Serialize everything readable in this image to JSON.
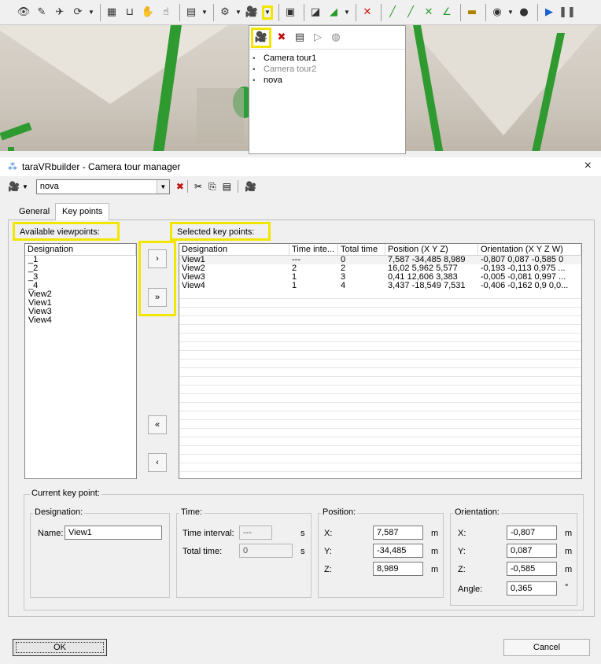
{
  "toolbar": {
    "icons": [
      "eye-icon",
      "walk-icon",
      "fly-icon",
      "rotate-icon",
      "grid-icon",
      "ruler-icon",
      "hand-icon",
      "pan-icon",
      "texture-icon",
      "settings-icon",
      "camera-icon",
      "camera-dropdown",
      "cube-icon",
      "chart-icon",
      "delete-icon",
      "line-icon",
      "measure-icon",
      "play-icon",
      "pause-icon"
    ]
  },
  "tour_panel": {
    "items": [
      {
        "label": "Camera tour1",
        "dim": false
      },
      {
        "label": "Camera tour2",
        "dim": true
      },
      {
        "label": "nova",
        "dim": false
      }
    ]
  },
  "dialog": {
    "title": "taraVRbuilder - Camera tour manager",
    "close": "×",
    "tour_select_value": "nova",
    "tabs": [
      "General",
      "Key points"
    ]
  },
  "available": {
    "label": "Available viewpoints:",
    "header": "Designation",
    "items": [
      "_1",
      "_2",
      "_3",
      "_4",
      "View2",
      "View1",
      "View3",
      "View4"
    ]
  },
  "buttons": {
    "add_one": "›",
    "add_all": "»",
    "remove_all": "«",
    "remove_one": "‹",
    "ok": "OK",
    "cancel": "Cancel"
  },
  "selected": {
    "label": "Selected key points:",
    "columns": [
      "Designation",
      "Time inte...",
      "Total time",
      "Position (X Y Z)",
      "Orientation (X Y Z W)"
    ],
    "rows": [
      [
        "View1",
        "---",
        "0",
        "7,587 -34,485 8,989",
        "-0,807 0,087 -0,585 0"
      ],
      [
        "View2",
        "2",
        "2",
        "16,02 5,962 5,577",
        "-0,193 -0,113 0,975 ..."
      ],
      [
        "View3",
        "1",
        "3",
        "0,41 12,606 3,383",
        "-0,005 -0,081 0,997 ..."
      ],
      [
        "View4",
        "1",
        "4",
        "3,437 -18,549 7,531",
        "-0,406 -0,162 0,9 0,0..."
      ]
    ]
  },
  "current": {
    "title": "Current key point:",
    "designation": {
      "title": "Designation:",
      "name_label": "Name:",
      "name_value": "View1"
    },
    "time": {
      "title": "Time:",
      "interval_label": "Time interval:",
      "interval_value": "---",
      "interval_unit": "s",
      "total_label": "Total time:",
      "total_value": "0",
      "total_unit": "s"
    },
    "position": {
      "title": "Position:",
      "x_label": "X:",
      "x": "7,587",
      "y_label": "Y:",
      "y": "-34,485",
      "z_label": "Z:",
      "z": "8,989",
      "unit": "m"
    },
    "orientation": {
      "title": "Orientation:",
      "x_label": "X:",
      "x": "-0,807",
      "y_label": "Y:",
      "y": "0,087",
      "z_label": "Z:",
      "z": "-0,585",
      "angle_label": "Angle:",
      "angle": "0,365",
      "unit": "m",
      "angle_unit": "°"
    }
  }
}
